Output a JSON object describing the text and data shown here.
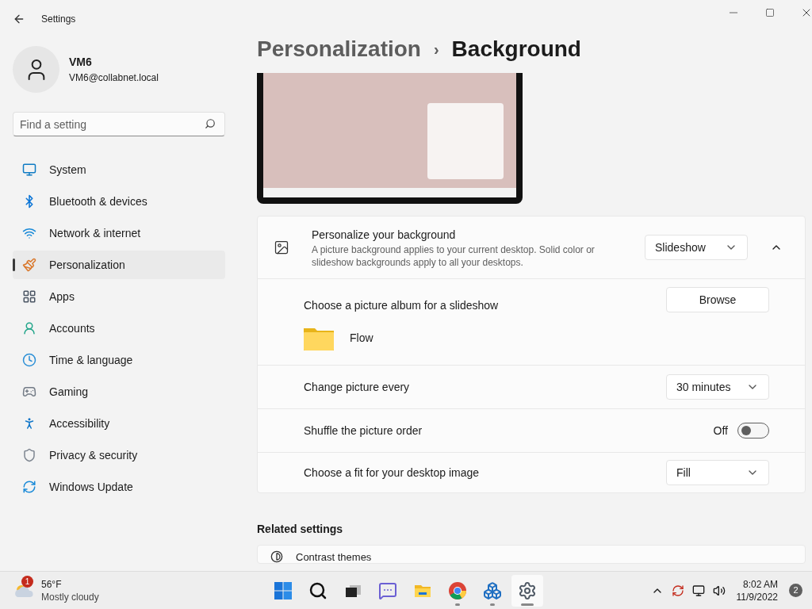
{
  "window": {
    "title": "Settings"
  },
  "user": {
    "name": "VM6",
    "email": "VM6@collabnet.local"
  },
  "search": {
    "placeholder": "Find a setting"
  },
  "nav": [
    {
      "kind": "system",
      "label": "System",
      "selected": false
    },
    {
      "kind": "bluetooth",
      "label": "Bluetooth & devices",
      "selected": false
    },
    {
      "kind": "network",
      "label": "Network & internet",
      "selected": false
    },
    {
      "kind": "brush",
      "label": "Personalization",
      "selected": true
    },
    {
      "kind": "apps",
      "label": "Apps",
      "selected": false
    },
    {
      "kind": "accounts",
      "label": "Accounts",
      "selected": false
    },
    {
      "kind": "time",
      "label": "Time & language",
      "selected": false
    },
    {
      "kind": "gaming",
      "label": "Gaming",
      "selected": false
    },
    {
      "kind": "accessibility",
      "label": "Accessibility",
      "selected": false
    },
    {
      "kind": "shield",
      "label": "Privacy & security",
      "selected": false
    },
    {
      "kind": "update",
      "label": "Windows Update",
      "selected": false
    }
  ],
  "breadcrumb": {
    "parent": "Personalization",
    "separator": "›",
    "current": "Background"
  },
  "background_card": {
    "title": "Personalize your background",
    "description": "A picture background applies to your current desktop. Solid color or slideshow backgrounds apply to all your desktops.",
    "value": "Slideshow",
    "expanded": true
  },
  "settings": [
    {
      "kind": "browse",
      "label": "Choose a picture album for a slideshow",
      "button": "Browse",
      "album": "Flow"
    },
    {
      "kind": "dropdown",
      "label": "Change picture every",
      "value": "30 minutes"
    },
    {
      "kind": "toggle",
      "label": "Shuffle the picture order",
      "state_text": "Off",
      "on": false
    },
    {
      "kind": "dropdown",
      "label": "Choose a fit for your desktop image",
      "value": "Fill"
    }
  ],
  "related": {
    "heading": "Related settings",
    "items": [
      "Contrast themes"
    ]
  },
  "taskbar": {
    "weather": {
      "badge": "1",
      "temperature": "56°F",
      "condition": "Mostly cloudy"
    },
    "apps": [
      {
        "kind": "start",
        "running": false,
        "selected": false
      },
      {
        "kind": "search",
        "running": false,
        "selected": false
      },
      {
        "kind": "taskview",
        "running": false,
        "selected": false
      },
      {
        "kind": "chat",
        "running": false,
        "selected": false
      },
      {
        "kind": "explorer",
        "running": false,
        "selected": false
      },
      {
        "kind": "chrome",
        "running": true,
        "selected": false
      },
      {
        "kind": "cubes",
        "running": true,
        "selected": false
      },
      {
        "kind": "settings",
        "running": true,
        "selected": true
      }
    ],
    "time": "8:02 AM",
    "date": "11/9/2022",
    "notifications": "2"
  }
}
